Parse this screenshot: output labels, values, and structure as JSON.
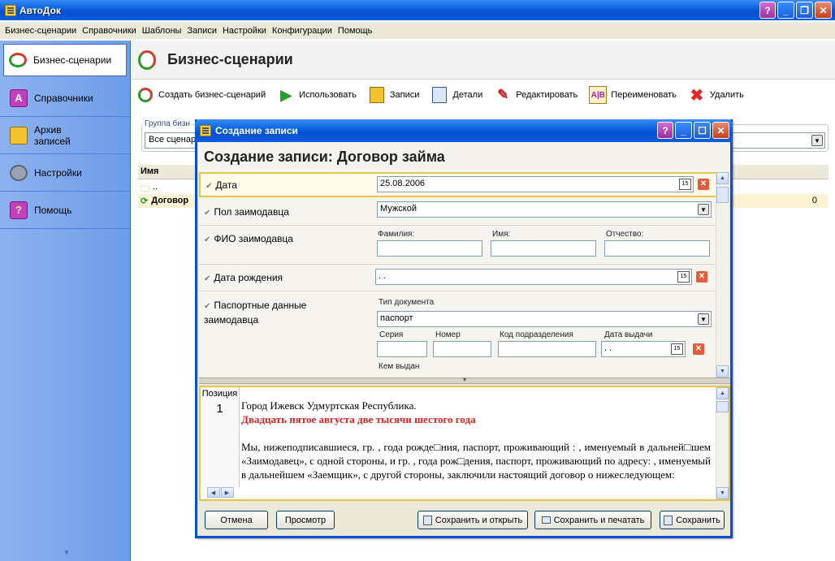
{
  "app": {
    "title": "АвтоДок"
  },
  "menu": [
    "Бизнес-сценарии",
    "Справочники",
    "Шаблоны",
    "Записи",
    "Настройки",
    "Конфигурации",
    "Помощь"
  ],
  "sidebar": {
    "items": [
      {
        "label": "Бизнес-сценарии",
        "icon": "business-scenarios-icon"
      },
      {
        "label": "Справочники",
        "icon": "reference-books-icon"
      },
      {
        "label": "Архив записей",
        "icon": "archive-icon"
      },
      {
        "label": "Настройки",
        "icon": "gear-icon"
      },
      {
        "label": "Помощь",
        "icon": "help-icon"
      }
    ]
  },
  "page": {
    "title": "Бизнес-сценарии"
  },
  "toolbar": {
    "create": "Создать бизнес-сценарий",
    "use": "Использовать",
    "records": "Записи",
    "details": "Детали",
    "edit": "Редактировать",
    "rename": "Переименовать",
    "delete": "Удалить"
  },
  "group": {
    "label": "Группа бизн",
    "value": "Все сценар"
  },
  "list": {
    "header": "Имя",
    "rows": [
      {
        "name": "..",
        "count": ""
      },
      {
        "name": "Договор",
        "count": "0"
      }
    ]
  },
  "dialog": {
    "title": "Создание записи",
    "heading": "Создание записи: Договор займа",
    "fields": {
      "date_label": "Дата",
      "date_value": "25.08.2006",
      "gender_label": "Пол заимодавца",
      "gender_value": "Мужской",
      "fio_label": "ФИО заимодавца",
      "surname_label": "Фамилия:",
      "name_label": "Имя:",
      "patronymic_label": "Отчество:",
      "birth_label": "Дата рождения",
      "birth_value": " . .",
      "passport_label": "Паспортные данные заимодавца",
      "doctype_label": "Тип документа",
      "doctype_value": "паспорт",
      "series_label": "Серия",
      "number_label": "Номер",
      "code_label": "Код подразделения",
      "issue_date_label": "Дата выдачи",
      "issue_date_value": " . .",
      "issued_by_label": "Кем выдан"
    },
    "document": {
      "position_label": "Позиция",
      "position_value": "1",
      "line1": "Город Ижевск Удмуртская Республика.",
      "line2": "Двадцать пятое августа две тысячи шестого года",
      "para": "Мы, нижеподписавшиеся, гр.   , года рожде□ния, паспорт,  проживающий : ,  именуемый  в дальней□шем «Заимодавец», с одной стороны, и гр.   ,  года рож□дения, паспорт, проживающий  по адресу: ,  именуемый  в дальнейшем «Заемщик», с другой стороны, заключили настоящий договор о нижеследующем:"
    },
    "buttons": {
      "cancel": "Отмена",
      "preview": "Просмотр",
      "save_open": "Сохранить и открыть",
      "save_print": "Сохранить и печатать",
      "save": "Сохранить"
    }
  }
}
